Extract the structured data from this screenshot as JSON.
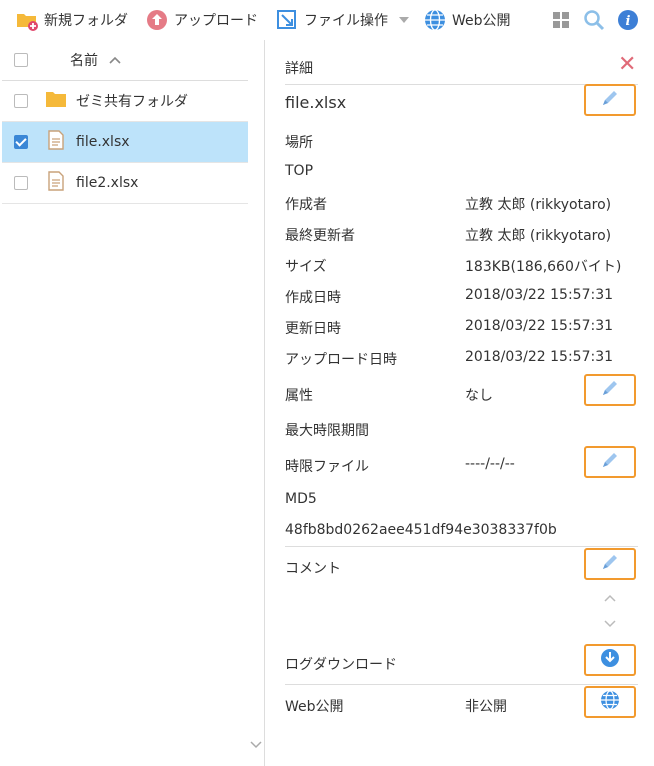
{
  "toolbar": {
    "new_folder": "新規フォルダ",
    "upload": "アップロード",
    "file_ops": "ファイル操作",
    "web_publish": "Web公開"
  },
  "file_list": {
    "header": "名前",
    "rows": [
      {
        "name": "ゼミ共有フォルダ",
        "type": "folder",
        "checked": false
      },
      {
        "name": "file.xlsx",
        "type": "file",
        "checked": true
      },
      {
        "name": "file2.xlsx",
        "type": "file",
        "checked": false
      }
    ]
  },
  "detail": {
    "title": "詳細",
    "filename": "file.xlsx",
    "location_label": "場所",
    "location_value": "TOP",
    "creator_label": "作成者",
    "creator_value": "立教 太郎 (rikkyotaro)",
    "updater_label": "最終更新者",
    "updater_value": "立教 太郎 (rikkyotaro)",
    "size_label": "サイズ",
    "size_value": "183KB(186,660バイト)",
    "created_label": "作成日時",
    "created_value": "2018/03/22 15:57:31",
    "updated_label": "更新日時",
    "updated_value": "2018/03/22 15:57:31",
    "uploaded_label": "アップロード日時",
    "uploaded_value": "2018/03/22 15:57:31",
    "attr_label": "属性",
    "attr_value": "なし",
    "max_period_label": "最大時限期間",
    "limit_file_label": "時限ファイル",
    "limit_file_value": "----/--/--",
    "md5_label": "MD5",
    "md5_value": "48fb8bd0262aee451df94e3038337f0b",
    "comment_label": "コメント",
    "log_download_label": "ログダウンロード",
    "web_publish_label": "Web公開",
    "web_publish_value": "非公開"
  },
  "colors": {
    "accent_orange": "#f29a2e",
    "selected_row": "#bde3fa",
    "check_blue": "#3a87d6",
    "close_red": "#e06a78",
    "icon_blue": "#3d8fe0"
  }
}
